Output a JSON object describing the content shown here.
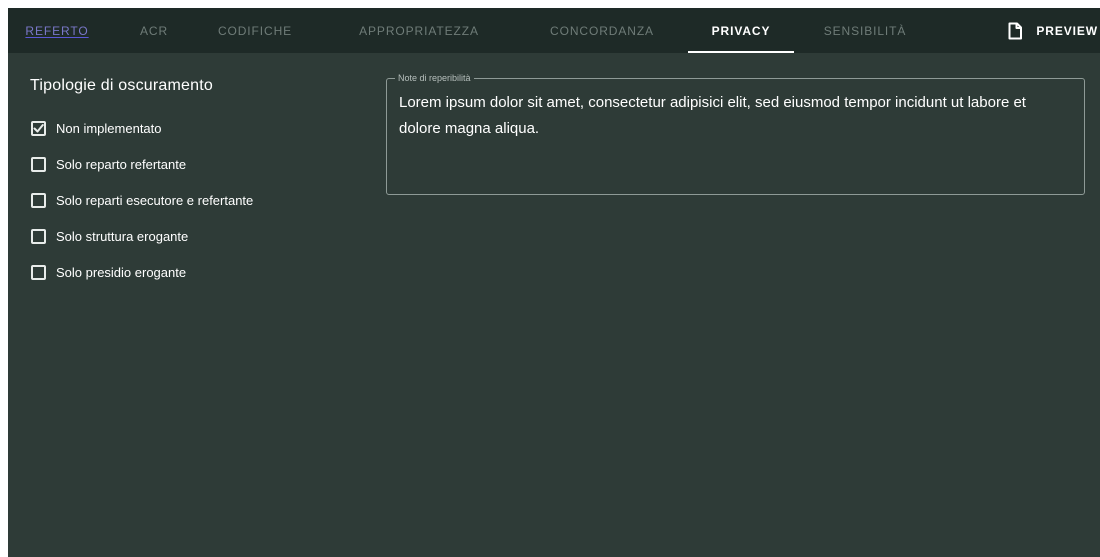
{
  "tabs": [
    {
      "id": "referto",
      "label": "REFERTO",
      "state": "visited"
    },
    {
      "id": "acr",
      "label": "ACR",
      "state": "inactive"
    },
    {
      "id": "codifiche",
      "label": "CODIFICHE",
      "state": "inactive"
    },
    {
      "id": "appropriatezza",
      "label": "APPROPRIATEZZA",
      "state": "inactive"
    },
    {
      "id": "concordanza",
      "label": "CONCORDANZA",
      "state": "inactive"
    },
    {
      "id": "privacy",
      "label": "PRIVACY",
      "state": "active"
    },
    {
      "id": "sensibilita",
      "label": "SENSIBILITÀ",
      "state": "inactive"
    }
  ],
  "preview": {
    "label": "PREVIEW",
    "icon": "document-icon"
  },
  "privacy": {
    "group_title": "Tipologie di oscuramento",
    "options": [
      {
        "label": "Non implementato",
        "checked": true
      },
      {
        "label": "Solo reparto refertante",
        "checked": false
      },
      {
        "label": "Solo reparti esecutore e refertante",
        "checked": false
      },
      {
        "label": "Solo struttura erogante",
        "checked": false
      },
      {
        "label": "Solo presidio erogante",
        "checked": false
      }
    ],
    "note": {
      "legend": "Note di reperibilità",
      "value": "Lorem ipsum dolor sit amet, consectetur adipisici elit, sed eiusmod tempor incidunt ut labore et dolore magna aliqua."
    }
  },
  "colors": {
    "background": "#2e3b37",
    "tabbar": "#1e2a27",
    "active_tab": "#ffffff",
    "inactive_tab": "#6f7c78",
    "visited_link": "#5b57d6"
  }
}
